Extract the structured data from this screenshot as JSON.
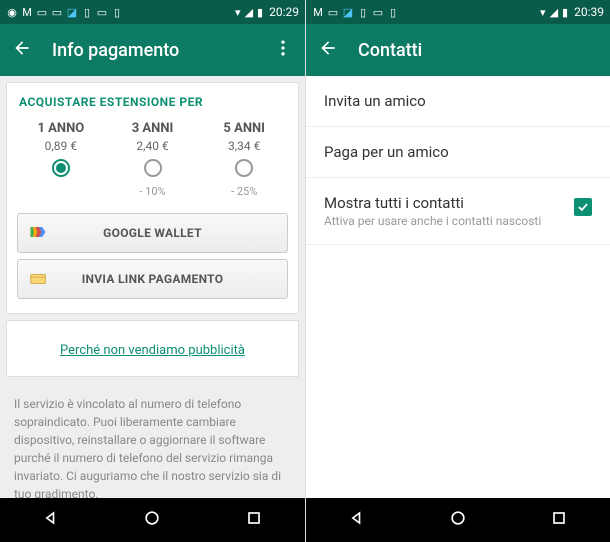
{
  "left": {
    "status": {
      "time": "20:29"
    },
    "header": {
      "title": "Info pagamento"
    },
    "sectionTitle": "ACQUISTARE ESTENSIONE PER",
    "plans": [
      {
        "label": "1 ANNO",
        "price": "0,89 €",
        "discount": "",
        "selected": true
      },
      {
        "label": "3 ANNI",
        "price": "2,40 €",
        "discount": "- 10%",
        "selected": false
      },
      {
        "label": "5 ANNI",
        "price": "3,34 €",
        "discount": "- 25%",
        "selected": false
      }
    ],
    "buttons": {
      "wallet": "GOOGLE WALLET",
      "sendLink": "INVIA LINK PAGAMENTO"
    },
    "adsLink": "Perché non vendiamo pubblicità",
    "disclaimer": "Il servizio è vincolato al numero di telefono sopraindicato. Puoi liberamente cambiare dispositivo, reinstallare o aggiornare il software purché il numero di telefono del servizio rimanga invariato. Ci auguriamo che il nostro servizio sia di tuo gradimento."
  },
  "right": {
    "status": {
      "time": "20:39"
    },
    "header": {
      "title": "Contatti"
    },
    "items": {
      "invite": "Invita un amico",
      "pay": "Paga per un amico",
      "showAll": {
        "title": "Mostra tutti i contatti",
        "sub": "Attiva per usare anche i contatti nascosti",
        "checked": true
      }
    }
  }
}
